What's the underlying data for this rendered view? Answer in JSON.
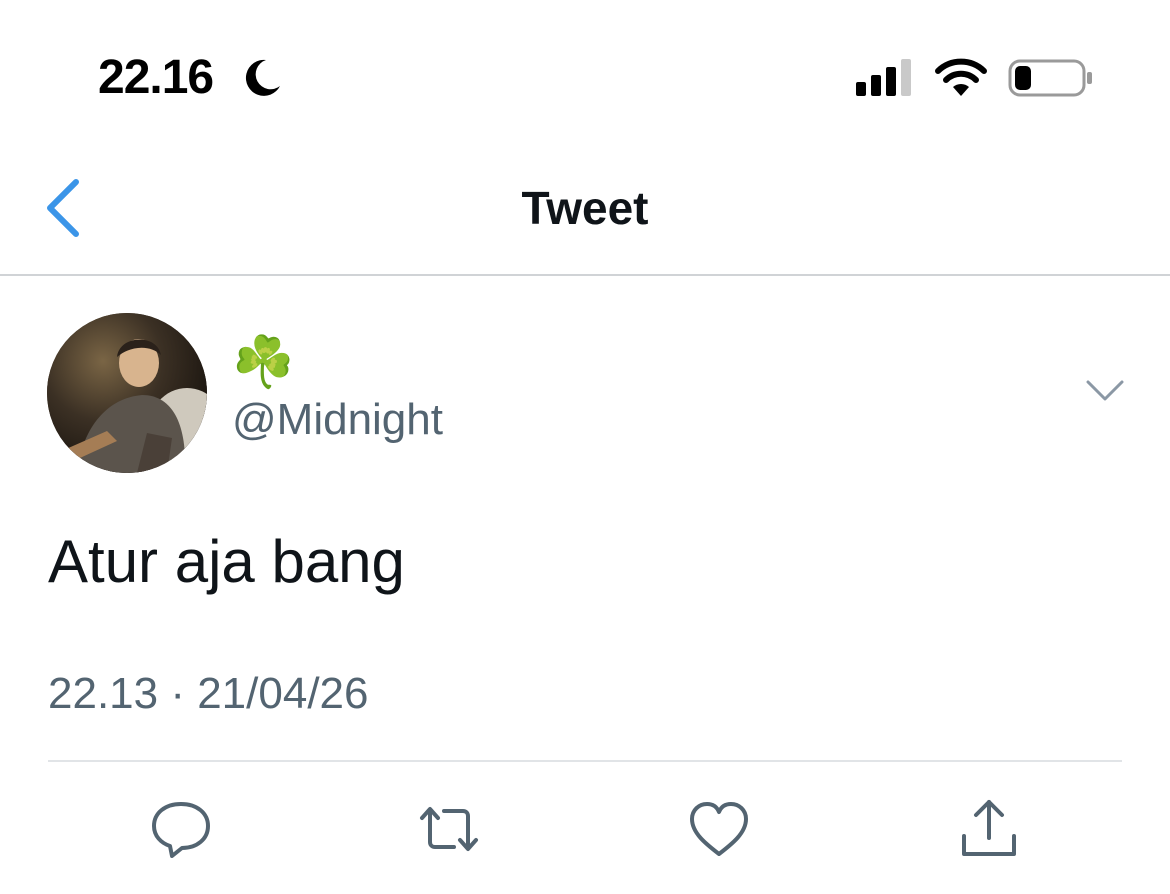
{
  "status_bar": {
    "time": "22.16",
    "icons": [
      "moon-icon",
      "cellular-signal-icon",
      "wifi-icon",
      "battery-icon"
    ]
  },
  "nav": {
    "back_icon": "chevron-left-icon",
    "title": "Tweet"
  },
  "tweet": {
    "display_name": "☘️",
    "handle": "@Midnight",
    "text": "Atur aja bang",
    "timestamp": "22.13 · 21/04/26",
    "more_icon": "chevron-down-icon"
  },
  "actions": [
    {
      "name": "reply",
      "icon": "reply-icon"
    },
    {
      "name": "retweet",
      "icon": "retweet-icon"
    },
    {
      "name": "like",
      "icon": "heart-icon"
    },
    {
      "name": "share",
      "icon": "share-icon"
    }
  ],
  "colors": {
    "accent": "#1d9bf0",
    "back_chevron": "#3b95e8",
    "secondary_text": "#536471",
    "primary_text": "#0f1419",
    "action_icon": "#536471"
  }
}
